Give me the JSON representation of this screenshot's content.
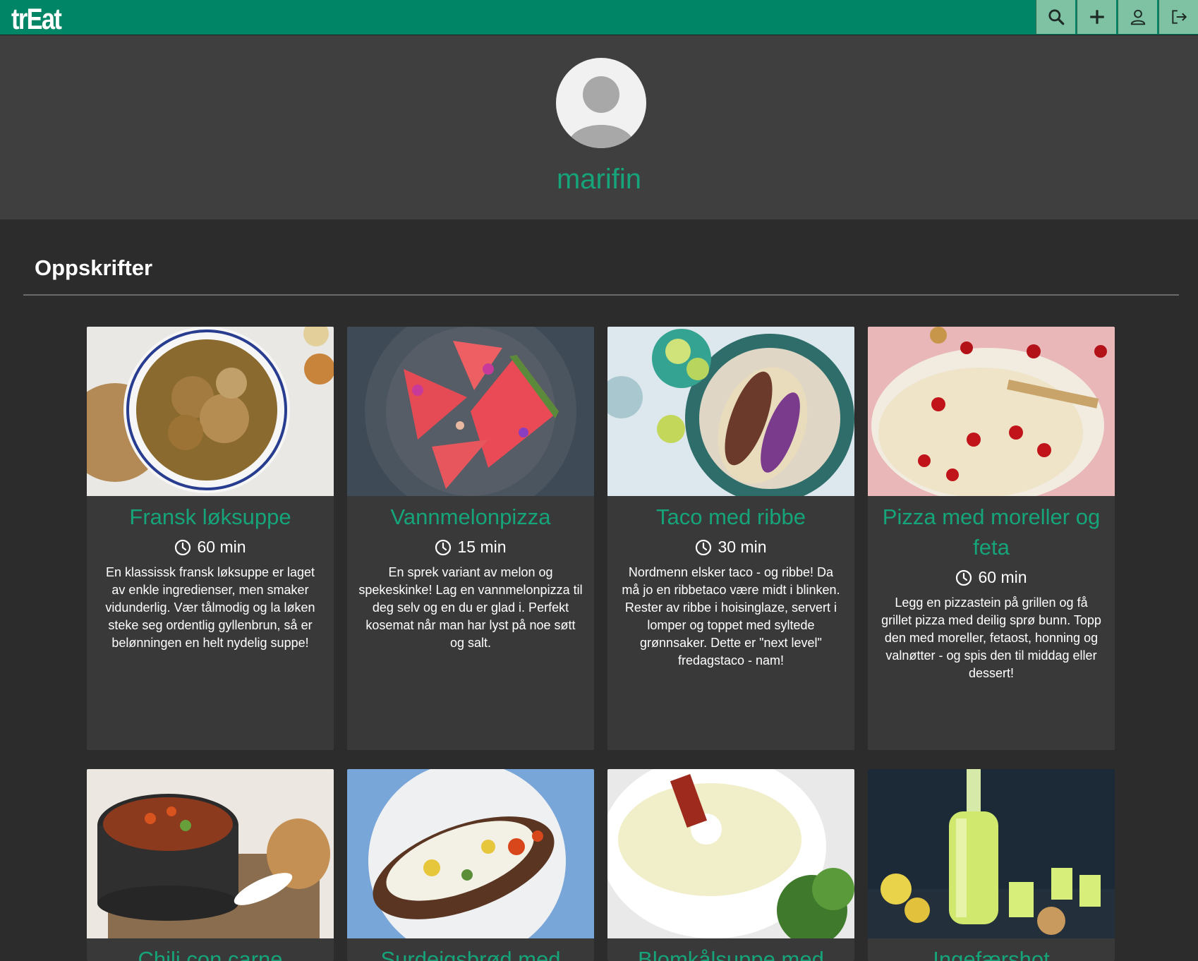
{
  "header": {
    "logo": "trEat",
    "buttons": [
      {
        "icon": "search-icon"
      },
      {
        "icon": "plus-icon"
      },
      {
        "icon": "user-icon"
      },
      {
        "icon": "logout-icon"
      }
    ]
  },
  "profile": {
    "username": "marifin"
  },
  "section": {
    "title": "Oppskrifter"
  },
  "recipes": [
    {
      "title": "Fransk løksuppe",
      "time": "60 min",
      "description": "En klassissk fransk løksuppe er laget av enkle ingredienser, men smaker vidunderlig. Vær tålmodig og la løken steke seg ordentlig gyllenbrun, så er belønningen en helt nydelig suppe!"
    },
    {
      "title": "Vannmelonpizza",
      "time": "15 min",
      "description": "En sprek variant av melon og spekeskinke! Lag en vannmelonpizza til deg selv og en du er glad i. Perfekt kosemat når man har lyst på noe søtt og salt."
    },
    {
      "title": "Taco med ribbe",
      "time": "30 min",
      "description": "Nordmenn elsker taco - og ribbe! Da må jo en ribbetaco være midt i blinken. Rester av ribbe i hoisinglaze, servert i lomper og toppet med syltede grønnsaker. Dette er \"next level\" fredagstaco - nam!"
    },
    {
      "title": "Pizza med moreller og feta",
      "time": "60 min",
      "description": "Legg en pizzastein på grillen og få grillet pizza med deilig sprø bunn. Topp den med moreller, fetaost, honning og valnøtter - og spis den til middag eller dessert!"
    },
    {
      "title": "Chili con carne",
      "time": "",
      "description": ""
    },
    {
      "title": "Surdeigsbrød med revet",
      "time": "",
      "description": ""
    },
    {
      "title": "Blomkålsuppe med",
      "time": "",
      "description": ""
    },
    {
      "title": "Ingefærshot",
      "time": "",
      "description": ""
    }
  ]
}
